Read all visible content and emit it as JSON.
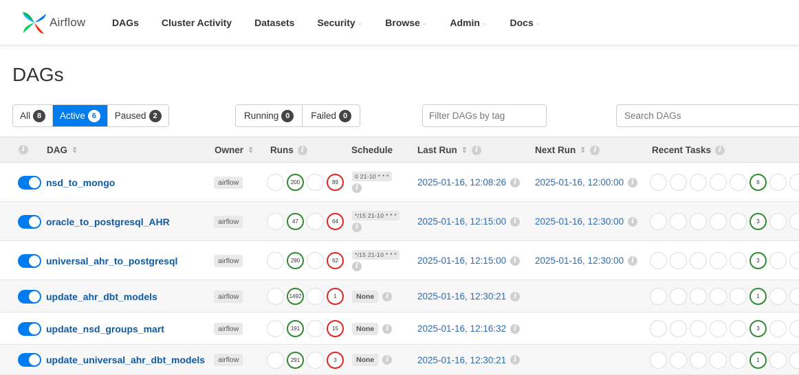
{
  "app": {
    "name": "Airflow"
  },
  "nav": [
    {
      "label": "DAGs",
      "dropdown": false
    },
    {
      "label": "Cluster Activity",
      "dropdown": false
    },
    {
      "label": "Datasets",
      "dropdown": false
    },
    {
      "label": "Security",
      "dropdown": true
    },
    {
      "label": "Browse",
      "dropdown": true
    },
    {
      "label": "Admin",
      "dropdown": true
    },
    {
      "label": "Docs",
      "dropdown": true
    }
  ],
  "page_title": "DAGs",
  "filters": {
    "status": [
      {
        "label": "All",
        "count": "8",
        "active": false
      },
      {
        "label": "Active",
        "count": "6",
        "active": true
      },
      {
        "label": "Paused",
        "count": "2",
        "active": false
      }
    ],
    "run_state": [
      {
        "label": "Running",
        "count": "0"
      },
      {
        "label": "Failed",
        "count": "0"
      }
    ],
    "tag_placeholder": "Filter DAGs by tag",
    "search_placeholder": "Search DAGs"
  },
  "columns": {
    "dag": "DAG",
    "owner": "Owner",
    "runs": "Runs",
    "schedule": "Schedule",
    "last_run": "Last Run",
    "next_run": "Next Run",
    "recent_tasks": "Recent Tasks"
  },
  "colors": {
    "accent": "#017cee",
    "success": "#2e8b2e",
    "failed": "#e02424",
    "link": "#0f5aa1"
  },
  "rows": [
    {
      "name": "nsd_to_mongo",
      "owner": "airflow",
      "runs_success": "200",
      "runs_failed": "89",
      "schedule": "0 21-10 * * *",
      "last_run": "2025-01-16, 12:08:26",
      "next_run": "2025-01-16, 12:00:00",
      "recent_success": "6"
    },
    {
      "name": "oracle_to_postgresql_AHR",
      "owner": "airflow",
      "runs_success": "47",
      "runs_failed": "64",
      "schedule": "*/15 21-10 * * *",
      "last_run": "2025-01-16, 12:15:00",
      "next_run": "2025-01-16, 12:30:00",
      "recent_success": "3"
    },
    {
      "name": "universal_ahr_to_postgresql",
      "owner": "airflow",
      "runs_success": "290",
      "runs_failed": "62",
      "schedule": "*/15 21-10 * * *",
      "last_run": "2025-01-16, 12:15:00",
      "next_run": "2025-01-16, 12:30:00",
      "recent_success": "3"
    },
    {
      "name": "update_ahr_dbt_models",
      "owner": "airflow",
      "runs_success": "1492",
      "runs_failed": "1",
      "schedule": "None",
      "last_run": "2025-01-16, 12:30:21",
      "next_run": "",
      "recent_success": "1"
    },
    {
      "name": "update_nsd_groups_mart",
      "owner": "airflow",
      "runs_success": "191",
      "runs_failed": "15",
      "schedule": "None",
      "last_run": "2025-01-16, 12:16:32",
      "next_run": "",
      "recent_success": "3"
    },
    {
      "name": "update_universal_ahr_dbt_models",
      "owner": "airflow",
      "runs_success": "291",
      "runs_failed": "3",
      "schedule": "None",
      "last_run": "2025-01-16, 12:30:21",
      "next_run": "",
      "recent_success": "1"
    }
  ]
}
